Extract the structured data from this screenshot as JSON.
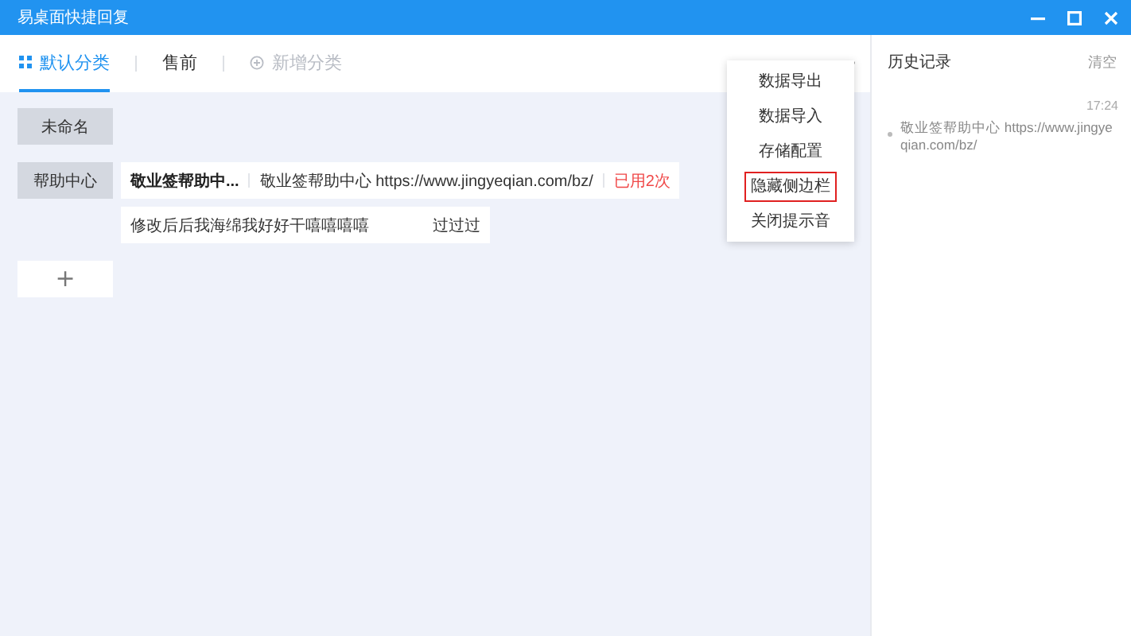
{
  "window": {
    "title": "易桌面快捷回复"
  },
  "tabs": [
    {
      "label": "默认分类",
      "selected": true,
      "kind": "category"
    },
    {
      "label": "售前",
      "selected": false,
      "kind": "category"
    },
    {
      "label": "新增分类",
      "selected": false,
      "kind": "add"
    }
  ],
  "menu": {
    "items": [
      {
        "label": "数据导出",
        "highlighted": false
      },
      {
        "label": "数据导入",
        "highlighted": false
      },
      {
        "label": "存储配置",
        "highlighted": false
      },
      {
        "label": "隐藏侧边栏",
        "highlighted": true
      },
      {
        "label": "关闭提示音",
        "highlighted": false
      }
    ]
  },
  "groups": [
    {
      "label": "未命名"
    },
    {
      "label": "帮助中心",
      "replies": [
        {
          "title": "敬业签帮助中...",
          "content": "敬业签帮助中心 https://www.jingyeqian.com/bz/",
          "usage": "已用2次"
        },
        {
          "content": "修改后后我海绵我好好干嘻嘻嘻嘻",
          "content_tail": "过过过"
        }
      ]
    }
  ],
  "add_group_button": "+",
  "history": {
    "title": "历史记录",
    "clear": "清空",
    "entries": [
      {
        "time": "17:24",
        "text": "敬业签帮助中心 https://www.jingyeqian.com/bz/"
      }
    ]
  }
}
